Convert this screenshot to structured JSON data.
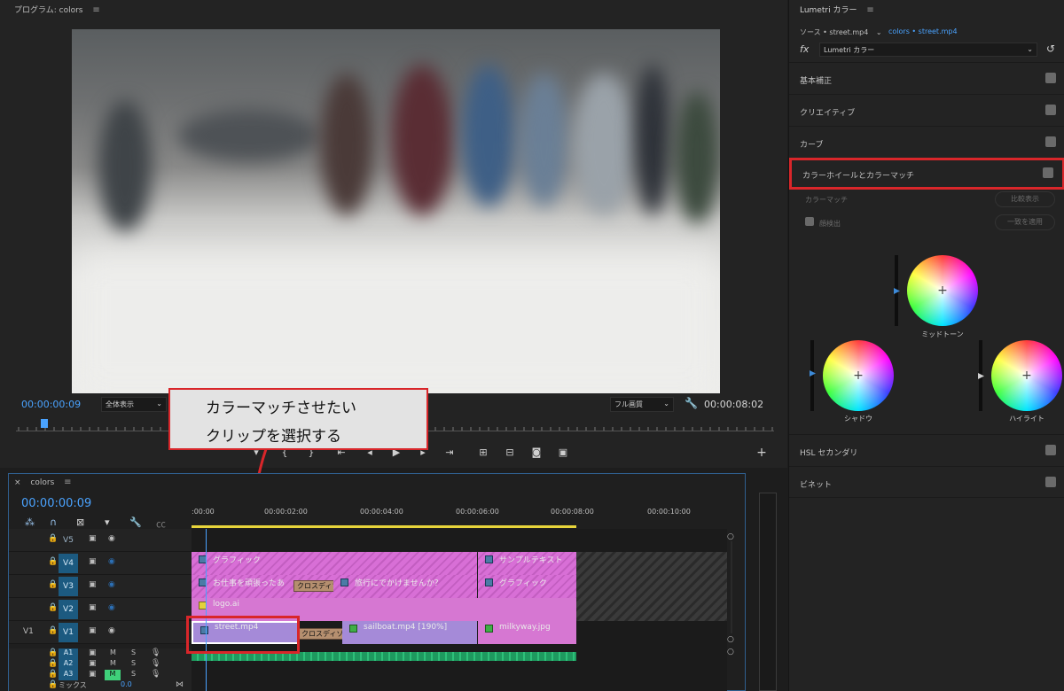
{
  "program": {
    "title": "プログラム: colors",
    "timecode_current": "00:00:00:09",
    "zoom": "全体表示",
    "quality": "フル画質",
    "timecode_duration": "00:00:08:02"
  },
  "callout": {
    "line1": "カラーマッチさせたい",
    "line2": "クリップを選択する"
  },
  "timeline": {
    "title": "colors",
    "timecode": "00:00:00:09",
    "ruler_labels": [
      ":00:00",
      "00:00:02:00",
      "00:00:04:00",
      "00:00:06:00",
      "00:00:08:00",
      "00:00:10:00"
    ],
    "tracks": {
      "v5": "V5",
      "v4": "V4",
      "v3": "V3",
      "v2": "V2",
      "v1": "V1",
      "v1_src": "V1",
      "a1": "A1",
      "a2": "A2",
      "a3": "A3",
      "mix": "ミックス",
      "mix_value": "0.0"
    },
    "clips": {
      "graphic1": "グラフィック",
      "sample_text": "サンプルテキスト",
      "oshigoto": "お仕事を頑張ったあ",
      "cross_dissolve": "クロスディゾ",
      "trip": "旅行にでかけませんか？",
      "graphic2": "グラフィック",
      "logo": "logo.ai",
      "street": "street.mp4",
      "sailboat": "sailboat.mp4 [190%]",
      "milkyway": "milkyway.jpg"
    },
    "audio_btns": {
      "m": "M",
      "s": "S"
    }
  },
  "lumetri": {
    "title": "Lumetri カラー",
    "source": "ソース • street.mp4",
    "sequence_clip": "colors • street.mp4",
    "effect_select": "Lumetri カラー",
    "sections": [
      "基本補正",
      "クリエイティブ",
      "カーブ",
      "カラーホイールとカラーマッチ",
      "HSL セカンダリ",
      "ビネット"
    ],
    "color_match_label": "カラーマッチ",
    "compare_btn": "比較表示",
    "face_detect": "顔検出",
    "apply_btn": "一致を適用",
    "wheels": {
      "midtone": "ミッドトーン",
      "shadow": "シャドウ",
      "highlight": "ハイライト"
    }
  },
  "colors": {
    "accent": "#4aa3ff",
    "highlight_red": "#d9262a",
    "clip_pink": "#d677d2",
    "clip_purple": "#a58ad8"
  }
}
